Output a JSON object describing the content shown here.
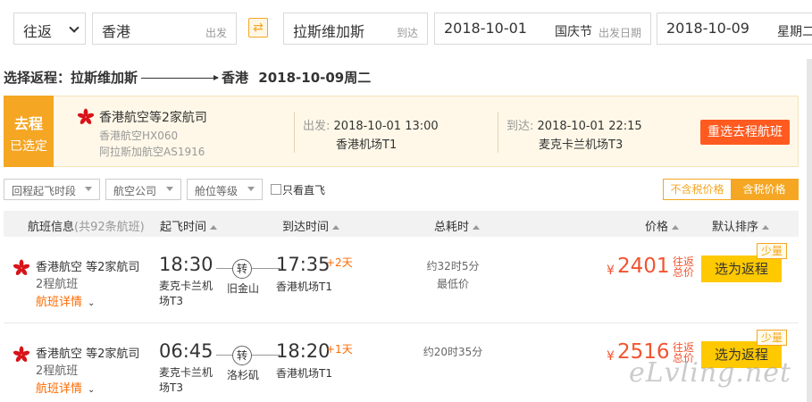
{
  "search": {
    "trip_type": "往返",
    "from_city": "香港",
    "from_tag": "出发",
    "to_city": "拉斯维加斯",
    "to_tag": "到达",
    "depart_date": "2018-10-01",
    "depart_holiday": "国庆节",
    "depart_tag": "出发日期",
    "return_date": "2018-10-09",
    "return_weekday": "星期二"
  },
  "page_title": {
    "prefix": "选择返程：",
    "from": "拉斯维加斯",
    "to": "香港",
    "date": "2018-10-09周二"
  },
  "outbound": {
    "badge_top": "去程",
    "badge_bottom": "已选定",
    "airline": "香港航空等2家航司",
    "flight1": "香港航空HX060",
    "flight2": "阿拉斯加航空AS1916",
    "depart_label": "出发:",
    "depart_time": "2018-10-01 13:00",
    "depart_airport": "香港机场T1",
    "arrive_label": "到达:",
    "arrive_time": "2018-10-01 22:15",
    "arrive_airport": "麦克卡兰机场T3",
    "reselect_label": "重选去程航班"
  },
  "filters": {
    "depart_time": "回程起飞时段",
    "airline": "航空公司",
    "cabin": "舱位等级",
    "direct_only": "只看直飞",
    "tax_excluded": "不含税价格",
    "tax_included": "含税价格"
  },
  "table_header": {
    "info": "航班信息",
    "count": "(共92条航班)",
    "depart": "起飞时间",
    "arrive": "到达时间",
    "duration": "总耗时",
    "price": "价格",
    "sort": "默认排序"
  },
  "flights": [
    {
      "airline": "香港航空 等2家航司",
      "legs": "2程航班",
      "details": "航班详情",
      "depart_time": "18:30",
      "depart_airport": "麦克卡兰机场T3",
      "transfer": "转",
      "transfer_city": "旧金山",
      "arrive_time": "17:35",
      "arrive_plus": "+2天",
      "arrive_airport": "香港机场T1",
      "duration": "约32时5分",
      "duration_note": "最低价",
      "currency": "¥",
      "price": "2401",
      "price_note": "往返总价",
      "button": "选为返程",
      "tag": "少量"
    },
    {
      "airline": "香港航空 等2家航司",
      "legs": "2程航班",
      "details": "航班详情",
      "depart_time": "06:45",
      "depart_airport": "麦克卡兰机场T3",
      "transfer": "转",
      "transfer_city": "洛杉矶",
      "arrive_time": "18:20",
      "arrive_plus": "+1天",
      "arrive_airport": "香港机场T1",
      "duration": "约20时35分",
      "duration_note": "",
      "currency": "¥",
      "price": "2516",
      "price_note": "往返总价",
      "button": "选为返程",
      "tag": "少量"
    }
  ],
  "watermark": "eLvling.net",
  "colors": {
    "accent": "#f5a623",
    "price": "#f25431",
    "button": "#ffc900",
    "reselect": "#ff5a1f",
    "logo": "#d7141a"
  }
}
